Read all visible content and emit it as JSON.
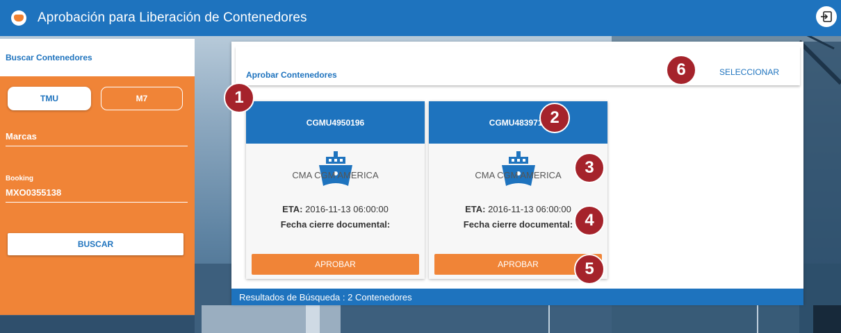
{
  "header": {
    "title": "Aprobación para Liberación de Contenedores",
    "logo_icon": "app-logo-icon",
    "logout_icon": "logout-icon"
  },
  "sidebar": {
    "title": "Buscar Contenedores",
    "tabs": [
      {
        "label": "TMU",
        "active": true
      },
      {
        "label": "M7",
        "active": false
      }
    ],
    "marcas_value": "Marcas",
    "booking_label": "Booking",
    "booking_value": "MXO0355138",
    "search_button": "BUSCAR"
  },
  "main": {
    "title": "Aprobar Contenedores",
    "select_link": "SELECCIONAR",
    "cards": [
      {
        "container": "CGMU4950196",
        "ship": "CMA CGM AMERICA",
        "eta_label": "ETA:",
        "eta_value": "2016-11-13 06:00:00",
        "fecha_label": "Fecha cierre documental:",
        "approve_button": "APROBAR"
      },
      {
        "container": "CGMU4839710",
        "ship": "CMA CGM AMERICA",
        "eta_label": "ETA:",
        "eta_value": "2016-11-13 06:00:00",
        "fecha_label": "Fecha cierre documental:",
        "approve_button": "APROBAR"
      }
    ],
    "results": "Resultados de Búsqueda : 2 Contenedores"
  },
  "markers": [
    "1",
    "2",
    "3",
    "4",
    "5",
    "6"
  ],
  "colors": {
    "primary": "#1e73be",
    "accent": "#f08437",
    "marker": "#a5232b"
  }
}
